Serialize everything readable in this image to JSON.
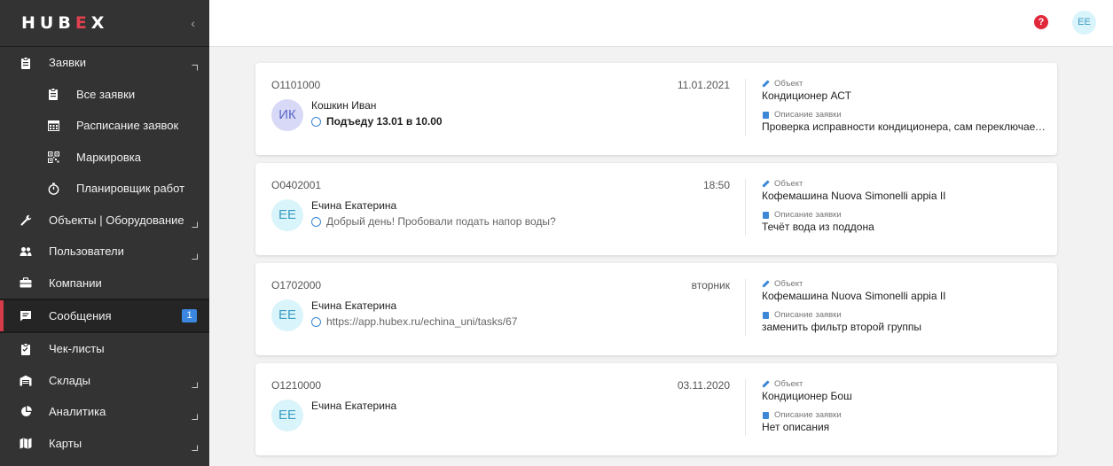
{
  "app": {
    "logo_pre": "HUB",
    "logo_accent": "E",
    "logo_post": "X",
    "collapse_glyph": "‹"
  },
  "sidebar": {
    "items": [
      {
        "label": "Заявки",
        "icon": "clipboard-icon",
        "caret": "up"
      },
      {
        "label": "Все заявки",
        "icon": "clipboard-list-icon"
      },
      {
        "label": "Расписание заявок",
        "icon": "calendar-icon"
      },
      {
        "label": "Маркировка",
        "icon": "qr-code-icon"
      },
      {
        "label": "Планировщик работ",
        "icon": "stopwatch-icon"
      },
      {
        "label": "Объекты | Оборудование",
        "icon": "wrench-icon",
        "caret": "down"
      },
      {
        "label": "Пользователи",
        "icon": "users-icon",
        "caret": "down"
      },
      {
        "label": "Компании",
        "icon": "briefcase-icon"
      },
      {
        "label": "Сообщения",
        "icon": "message-icon",
        "badge": "1",
        "active": true
      },
      {
        "label": "Чек-листы",
        "icon": "checklist-icon"
      },
      {
        "label": "Склады",
        "icon": "warehouse-icon",
        "caret": "down"
      },
      {
        "label": "Аналитика",
        "icon": "pie-chart-icon",
        "caret": "down"
      },
      {
        "label": "Карты",
        "icon": "map-icon",
        "caret": "down"
      }
    ]
  },
  "header": {
    "help_glyph": "?",
    "user_initials": "ЕЕ",
    "help_color": "#e0283a"
  },
  "messages": [
    {
      "number": "О1101000",
      "date": "11.01.2021",
      "initials": "ИК",
      "name": "Кошкин Иван",
      "text": "Подъеду 13.01 в 10.00",
      "object_label": "Объект",
      "object": "Кондиционер АСТ",
      "desc_label": "Описание заявки",
      "desc": "Проверка исправности кондиционера, сам переключается"
    },
    {
      "number": "О0402001",
      "date": "18:50",
      "initials": "ЕЕ",
      "name": "Ечина Екатерина",
      "text": "Добрый день! Пробовали подать напор воды?",
      "object_label": "Объект",
      "object": "Кофемашина Nuova Simonelli appia II",
      "desc_label": "Описание заявки",
      "desc": "Течёт вода из поддона"
    },
    {
      "number": "О1702000",
      "date": "вторник",
      "initials": "ЕЕ",
      "name": "Ечина Екатерина",
      "text": "https://app.hubex.ru/echina_uni/tasks/67",
      "object_label": "Объект",
      "object": "Кофемашина Nuova Simonelli appia II",
      "desc_label": "Описание заявки",
      "desc": "заменить фильтр второй группы"
    },
    {
      "number": "О1210000",
      "date": "03.11.2020",
      "initials": "ЕЕ",
      "name": "Ечина Екатерина",
      "text": "",
      "object_label": "Объект",
      "object": "Кондиционер Бош",
      "desc_label": "Описание заявки",
      "desc": "Нет описания"
    }
  ],
  "colors": {
    "sidebar_bg": "#333333",
    "active_marker": "#d63b4a",
    "badge_bg": "#3b87e0",
    "accent_blue": "#3d88d6"
  }
}
